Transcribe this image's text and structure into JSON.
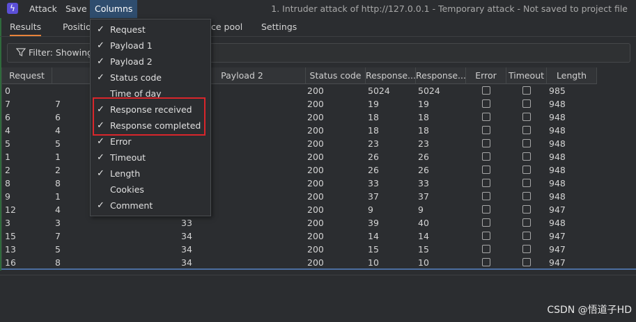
{
  "app": {
    "icon": "burp-lightning-icon"
  },
  "menus": [
    "Attack",
    "Save",
    "Columns"
  ],
  "window_title": "1. Intruder attack of http://127.0.0.1 - Temporary attack - Not saved to project file",
  "tabs": [
    "Results",
    "Positio",
    "ce pool",
    "Settings"
  ],
  "filter": {
    "text": "Filter: Showing a"
  },
  "columns_menu": [
    {
      "label": "Request",
      "checked": true
    },
    {
      "label": "Payload 1",
      "checked": true
    },
    {
      "label": "Payload 2",
      "checked": true
    },
    {
      "label": "Status code",
      "checked": true
    },
    {
      "label": "Time of day",
      "checked": false
    },
    {
      "label": "Response received",
      "checked": true
    },
    {
      "label": "Response completed",
      "checked": true
    },
    {
      "label": "Error",
      "checked": true
    },
    {
      "label": "Timeout",
      "checked": true
    },
    {
      "label": "Length",
      "checked": true
    },
    {
      "label": "Cookies",
      "checked": false
    },
    {
      "label": "Comment",
      "checked": true
    }
  ],
  "table": {
    "headers": [
      "Request",
      "",
      "Payload 2",
      "Status code",
      "Response...",
      "Response...",
      "Error",
      "Timeout",
      "Length"
    ],
    "rows": [
      {
        "request": "0",
        "p1": "",
        "p2": "",
        "status": "200",
        "recv": "5024",
        "comp": "5024",
        "length": "985"
      },
      {
        "request": "7",
        "p1": "7",
        "p2": "",
        "status": "200",
        "recv": "19",
        "comp": "19",
        "length": "948"
      },
      {
        "request": "6",
        "p1": "6",
        "p2": "",
        "status": "200",
        "recv": "18",
        "comp": "18",
        "length": "948"
      },
      {
        "request": "4",
        "p1": "4",
        "p2": "",
        "status": "200",
        "recv": "18",
        "comp": "18",
        "length": "948"
      },
      {
        "request": "5",
        "p1": "5",
        "p2": "",
        "status": "200",
        "recv": "23",
        "comp": "23",
        "length": "948"
      },
      {
        "request": "1",
        "p1": "1",
        "p2": "",
        "status": "200",
        "recv": "26",
        "comp": "26",
        "length": "948"
      },
      {
        "request": "2",
        "p1": "2",
        "p2": "",
        "status": "200",
        "recv": "26",
        "comp": "26",
        "length": "948"
      },
      {
        "request": "8",
        "p1": "8",
        "p2": "",
        "status": "200",
        "recv": "33",
        "comp": "33",
        "length": "948"
      },
      {
        "request": "9",
        "p1": "1",
        "p2": "",
        "status": "200",
        "recv": "37",
        "comp": "37",
        "length": "948"
      },
      {
        "request": "12",
        "p1": "4",
        "p2": "",
        "status": "200",
        "recv": "9",
        "comp": "9",
        "length": "947"
      },
      {
        "request": "3",
        "p1": "3",
        "p2": "33",
        "status": "200",
        "recv": "39",
        "comp": "40",
        "length": "948"
      },
      {
        "request": "15",
        "p1": "7",
        "p2": "34",
        "status": "200",
        "recv": "14",
        "comp": "14",
        "length": "947"
      },
      {
        "request": "13",
        "p1": "5",
        "p2": "34",
        "status": "200",
        "recv": "15",
        "comp": "15",
        "length": "947"
      },
      {
        "request": "16",
        "p1": "8",
        "p2": "34",
        "status": "200",
        "recv": "10",
        "comp": "10",
        "length": "947"
      }
    ]
  },
  "watermark": "CSDN @悟道子HD",
  "colors": {
    "highlight": "#d9262b",
    "active_menu": "#2f4d6e",
    "active_tab": "#e8833a"
  }
}
